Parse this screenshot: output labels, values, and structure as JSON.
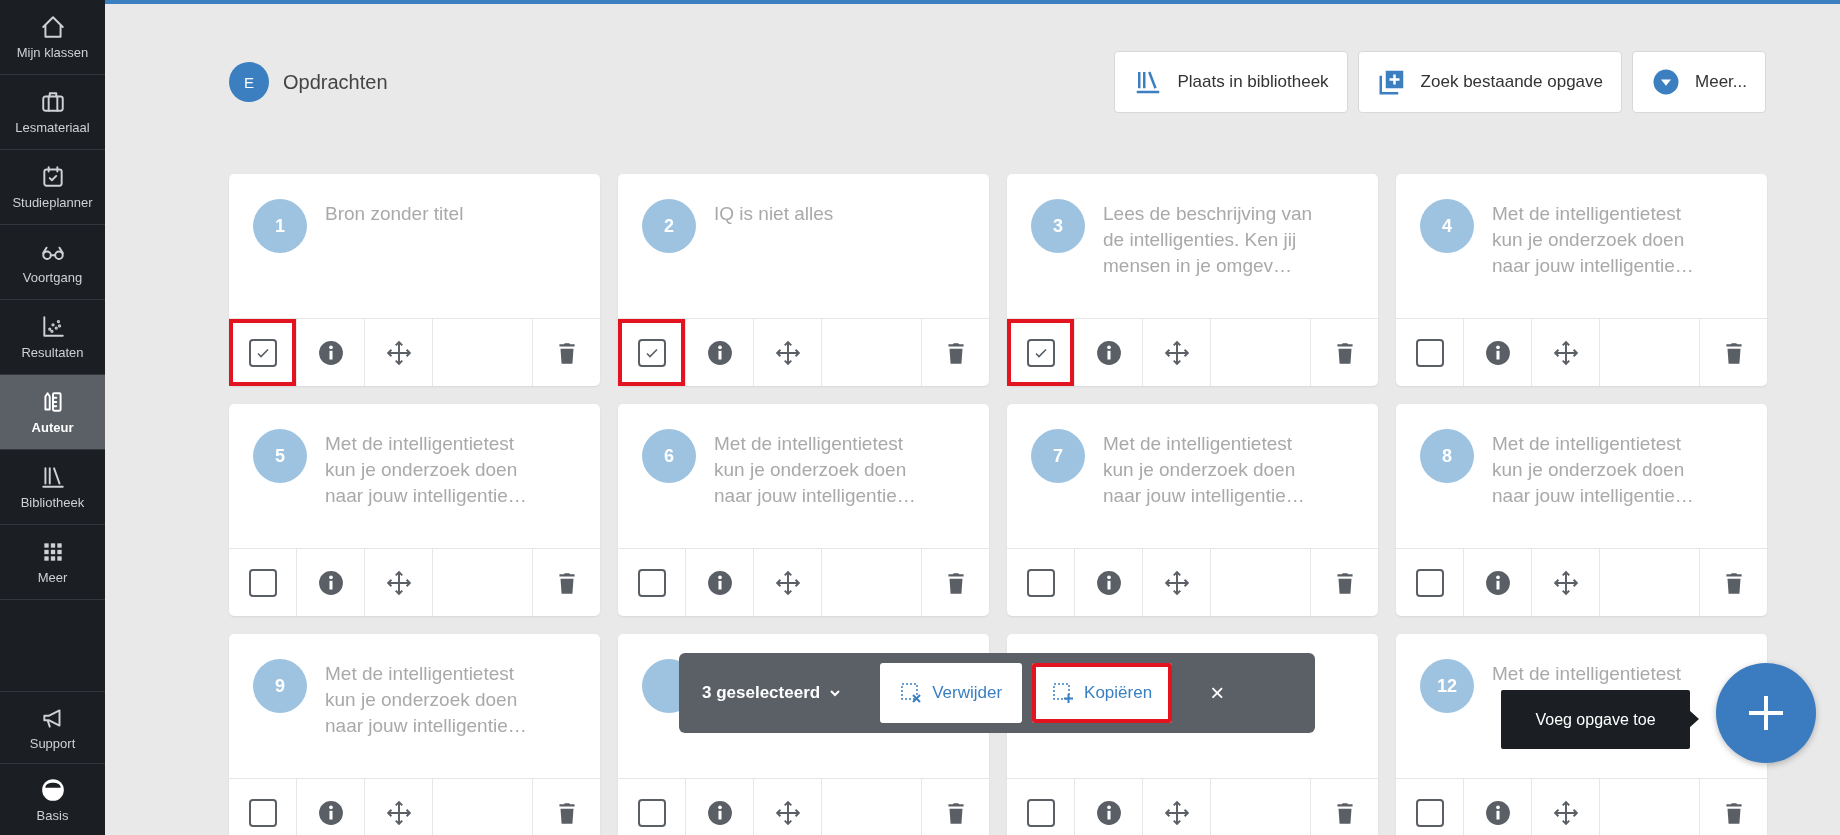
{
  "sidebar": {
    "items": [
      {
        "label": "Mijn klassen",
        "selected": false
      },
      {
        "label": "Lesmateriaal",
        "selected": false
      },
      {
        "label": "Studieplanner",
        "selected": false
      },
      {
        "label": "Voortgang",
        "selected": false
      },
      {
        "label": "Resultaten",
        "selected": false
      },
      {
        "label": "Auteur",
        "selected": true
      },
      {
        "label": "Bibliotheek",
        "selected": false
      },
      {
        "label": "Meer",
        "selected": false
      }
    ],
    "bottom_items": [
      {
        "label": "Support"
      },
      {
        "label": "Basis"
      }
    ]
  },
  "header": {
    "badge": "E",
    "title": "Opdrachten",
    "buttons": [
      {
        "label": "Plaats in bibliotheek"
      },
      {
        "label": "Zoek bestaande opgave"
      },
      {
        "label": "Meer..."
      }
    ]
  },
  "cards": [
    {
      "number": "1",
      "title": "Bron zonder titel",
      "checked": true,
      "highlighted": true
    },
    {
      "number": "2",
      "title": "IQ is niet alles",
      "checked": true,
      "highlighted": true
    },
    {
      "number": "3",
      "title": "Lees de beschrijving van de intelligenties. Ken jij mensen in je omgev…",
      "checked": true,
      "highlighted": true
    },
    {
      "number": "4",
      "title": "Met de intelligentietest kun je onderzoek doen naar jouw intelligentie…",
      "checked": false,
      "highlighted": false
    },
    {
      "number": "5",
      "title": "Met de intelligentietest kun je onderzoek doen naar jouw intelligentie…",
      "checked": false,
      "highlighted": false
    },
    {
      "number": "6",
      "title": "Met de intelligentietest kun je onderzoek doen naar jouw intelligentie…",
      "checked": false,
      "highlighted": false
    },
    {
      "number": "7",
      "title": "Met de intelligentietest kun je onderzoek doen naar jouw intelligentie…",
      "checked": false,
      "highlighted": false
    },
    {
      "number": "8",
      "title": "Met de intelligentietest kun je onderzoek doen naar jouw intelligentie…",
      "checked": false,
      "highlighted": false
    },
    {
      "number": "9",
      "title": "Met de intelligentietest kun je onderzoek doen naar jouw intelligentie…",
      "checked": false,
      "highlighted": false
    },
    {
      "badge_visible": true,
      "checked": false,
      "highlighted": false
    },
    {
      "badge_visible": false,
      "checked": false,
      "highlighted": false
    },
    {
      "number": "12",
      "title": "Met de intelligentietest",
      "checked": false,
      "highlighted": false
    }
  ],
  "selection_bar": {
    "count_label": "3 geselecteerd",
    "buttons": [
      {
        "label": "Verwijder",
        "highlighted": false
      },
      {
        "label": "Kopiëren",
        "highlighted": true
      }
    ],
    "close": "×"
  },
  "tooltip": "Voeg opgave toe"
}
